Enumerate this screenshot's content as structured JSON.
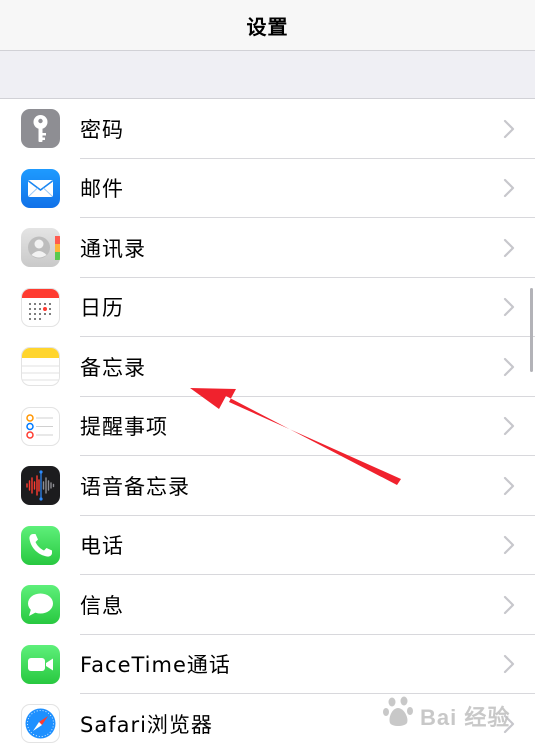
{
  "nav": {
    "title": "设置"
  },
  "settings_items": [
    {
      "label": "密码",
      "icon": "key-icon"
    },
    {
      "label": "邮件",
      "icon": "mail-icon"
    },
    {
      "label": "通讯录",
      "icon": "contacts-icon"
    },
    {
      "label": "日历",
      "icon": "calendar-icon"
    },
    {
      "label": "备忘录",
      "icon": "notes-icon"
    },
    {
      "label": "提醒事项",
      "icon": "reminders-icon"
    },
    {
      "label": "语音备忘录",
      "icon": "voice-memos-icon"
    },
    {
      "label": "电话",
      "icon": "phone-icon"
    },
    {
      "label": "信息",
      "icon": "messages-icon"
    },
    {
      "label": "FaceTime通话",
      "icon": "facetime-icon"
    },
    {
      "label": "Safari浏览器",
      "icon": "safari-icon"
    }
  ],
  "watermark": {
    "text": "Bai 经验"
  },
  "colors": {
    "nav_background": "#f7f7f7",
    "group_background": "#efeff4",
    "separator": "#d8d8dc",
    "chevron": "#c7c7cc",
    "annotation_arrow": "#f0222d",
    "mail_blue": "#1e9bff",
    "ios_green": "#28c840"
  }
}
